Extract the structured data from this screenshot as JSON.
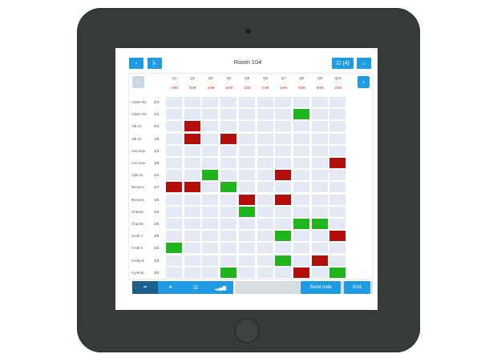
{
  "toolbar": {
    "title": "Room 104",
    "back_glyph": "‹",
    "first_glyph": "|‹",
    "edit_label": "☑ (4)",
    "home_glyph": "⌂"
  },
  "grid_nav": {
    "left_glyph": "‹",
    "right_glyph": "›"
  },
  "columns": [
    {
      "name": "Q1",
      "score": "2/49"
    },
    {
      "name": "Q2",
      "score": "3/49"
    },
    {
      "name": "Q3",
      "score": "4/49"
    },
    {
      "name": "Q4",
      "score": "5/49"
    },
    {
      "name": "Q5",
      "score": "1/49"
    },
    {
      "name": "Q6",
      "score": "1/49"
    },
    {
      "name": "Q7",
      "score": "5/49"
    },
    {
      "name": "Q8",
      "score": "4/49"
    },
    {
      "name": "Q9",
      "score": "3/49"
    },
    {
      "name": "Q10",
      "score": "2/49"
    }
  ],
  "rows": [
    {
      "name": "Adam Re",
      "score": "2/3",
      "cells": [
        "",
        "",
        "",
        "",
        "",
        "",
        "",
        "",
        "",
        ""
      ]
    },
    {
      "name": "Adam Re",
      "score": "1/1",
      "cells": [
        "",
        "",
        "",
        "",
        "",
        "",
        "",
        "green",
        "",
        ""
      ]
    },
    {
      "name": "Alb Sc",
      "score": "0/4",
      "cells": [
        "",
        "red",
        "",
        "",
        "",
        "",
        "",
        "",
        "",
        ""
      ]
    },
    {
      "name": "Alb Sc",
      "score": "1/6",
      "cells": [
        "",
        "red",
        "",
        "red",
        "",
        "",
        "",
        "",
        "",
        ""
      ]
    },
    {
      "name": "Ava Gao",
      "score": "1/4",
      "cells": [
        "",
        "",
        "",
        "",
        "",
        "",
        "",
        "",
        "",
        ""
      ]
    },
    {
      "name": "Ava Gao",
      "score": "1/6",
      "cells": [
        "",
        "",
        "",
        "",
        "",
        "",
        "",
        "",
        "",
        "red"
      ]
    },
    {
      "name": "Aylin B",
      "score": "2/4",
      "cells": [
        "",
        "",
        "green",
        "",
        "",
        "",
        "red",
        "",
        "",
        ""
      ]
    },
    {
      "name": "Bonacci",
      "score": "4/7",
      "cells": [
        "red",
        "red",
        "",
        "green",
        "",
        "",
        "",
        "",
        "",
        ""
      ]
    },
    {
      "name": "Bonacci",
      "score": "1/5",
      "cells": [
        "",
        "",
        "",
        "",
        "red",
        "",
        "red",
        "",
        "",
        ""
      ]
    },
    {
      "name": "Charles",
      "score": "1/2",
      "cells": [
        "",
        "",
        "",
        "",
        "green",
        "",
        "",
        "",
        "",
        ""
      ]
    },
    {
      "name": "Charles",
      "score": "4/6",
      "cells": [
        "",
        "",
        "",
        "",
        "",
        "",
        "",
        "green",
        "green",
        ""
      ]
    },
    {
      "name": "Cindi C",
      "score": "3/6",
      "cells": [
        "",
        "",
        "",
        "",
        "",
        "",
        "green",
        "",
        "",
        "red"
      ]
    },
    {
      "name": "Cindi C",
      "score": "2/2",
      "cells": [
        "green",
        "",
        "",
        "",
        "",
        "",
        "",
        "",
        "",
        ""
      ]
    },
    {
      "name": "Cindy B",
      "score": "1/3",
      "cells": [
        "",
        "",
        "",
        "",
        "",
        "",
        "green",
        "",
        "red",
        ""
      ]
    },
    {
      "name": "Cynthia",
      "score": "3/4",
      "cells": [
        "",
        "",
        "",
        "green",
        "",
        "",
        "",
        "red",
        "",
        "green"
      ]
    }
  ],
  "footer": {
    "segments": [
      {
        "name": "grid-view-tab",
        "glyph": "▪▪",
        "active": true
      },
      {
        "name": "person-tab",
        "glyph": "●",
        "active": false
      },
      {
        "name": "check-tab",
        "glyph": "☑",
        "active": false
      },
      {
        "name": "stats-tab",
        "glyph": "▂▄▆",
        "active": false
      }
    ],
    "send_label": "Send note",
    "end_label": "End"
  },
  "colors": {
    "accent": "#1e9be3",
    "accent_dark": "#1a5f8d",
    "correct": "#20b51c",
    "incorrect": "#b50d0a",
    "empty": "#e3e8f4",
    "bezel": "#353a3a"
  }
}
